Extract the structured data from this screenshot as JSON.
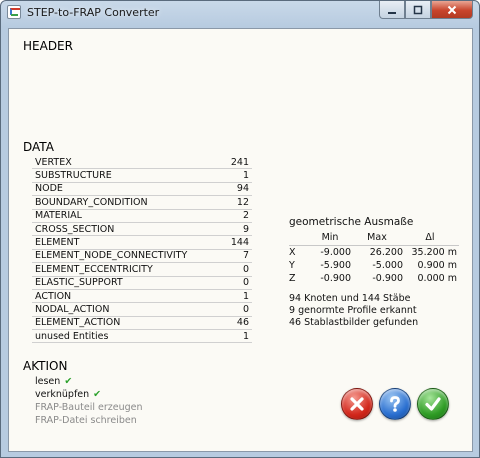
{
  "window": {
    "title": "STEP-to-FRAP Converter"
  },
  "header": {
    "title": "HEADER",
    "lines": [
      "",
      "",
      "",
      "",
      "",
      "",
      "",
      ""
    ]
  },
  "data": {
    "title": "DATA",
    "rows": [
      {
        "label": "VERTEX",
        "value": "241"
      },
      {
        "label": "SUBSTRUCTURE",
        "value": "1"
      },
      {
        "label": "NODE",
        "value": "94"
      },
      {
        "label": "BOUNDARY_CONDITION",
        "value": "12"
      },
      {
        "label": "MATERIAL",
        "value": "2"
      },
      {
        "label": "CROSS_SECTION",
        "value": "9"
      },
      {
        "label": "ELEMENT",
        "value": "144"
      },
      {
        "label": "ELEMENT_NODE_CONNECTIVITY",
        "value": "7"
      },
      {
        "label": "ELEMENT_ECCENTRICITY",
        "value": "0"
      },
      {
        "label": "ELASTIC_SUPPORT",
        "value": "0"
      },
      {
        "label": "ACTION",
        "value": "1"
      },
      {
        "label": "NODAL_ACTION",
        "value": "0"
      },
      {
        "label": "ELEMENT_ACTION",
        "value": "46"
      },
      {
        "label": "unused Entities",
        "value": "1"
      }
    ]
  },
  "geometry": {
    "title": "geometrische Ausmaße",
    "columns": [
      "",
      "Min",
      "Max",
      "Δl"
    ],
    "rows": [
      {
        "axis": "X",
        "min": "-9.000",
        "max": "26.200",
        "delta": "35.200 m"
      },
      {
        "axis": "Y",
        "min": "-5.900",
        "max": "-5.000",
        "delta": "0.900 m"
      },
      {
        "axis": "Z",
        "min": "-0.900",
        "max": "-0.900",
        "delta": "0.000 m"
      }
    ],
    "summary": [
      "94 Knoten und 144 Stäbe",
      "9 genormte Profile erkannt",
      "46 Stablastbilder gefunden"
    ]
  },
  "actions": {
    "title": "AKTION",
    "items": [
      {
        "label": "lesen",
        "done": true
      },
      {
        "label": "verknüpfen",
        "done": true
      },
      {
        "label": "FRAP-Bauteil erzeugen",
        "done": false
      },
      {
        "label": "FRAP-Datei schreiben",
        "done": false
      }
    ]
  },
  "buttons": {
    "cancel_icon": "close-x-icon",
    "help_icon": "question-icon",
    "ok_icon": "checkmark-icon"
  },
  "colors": {
    "cancel": "#d2281c",
    "help": "#2a6fd0",
    "ok": "#2f9c25",
    "check": "#2aa02a"
  }
}
